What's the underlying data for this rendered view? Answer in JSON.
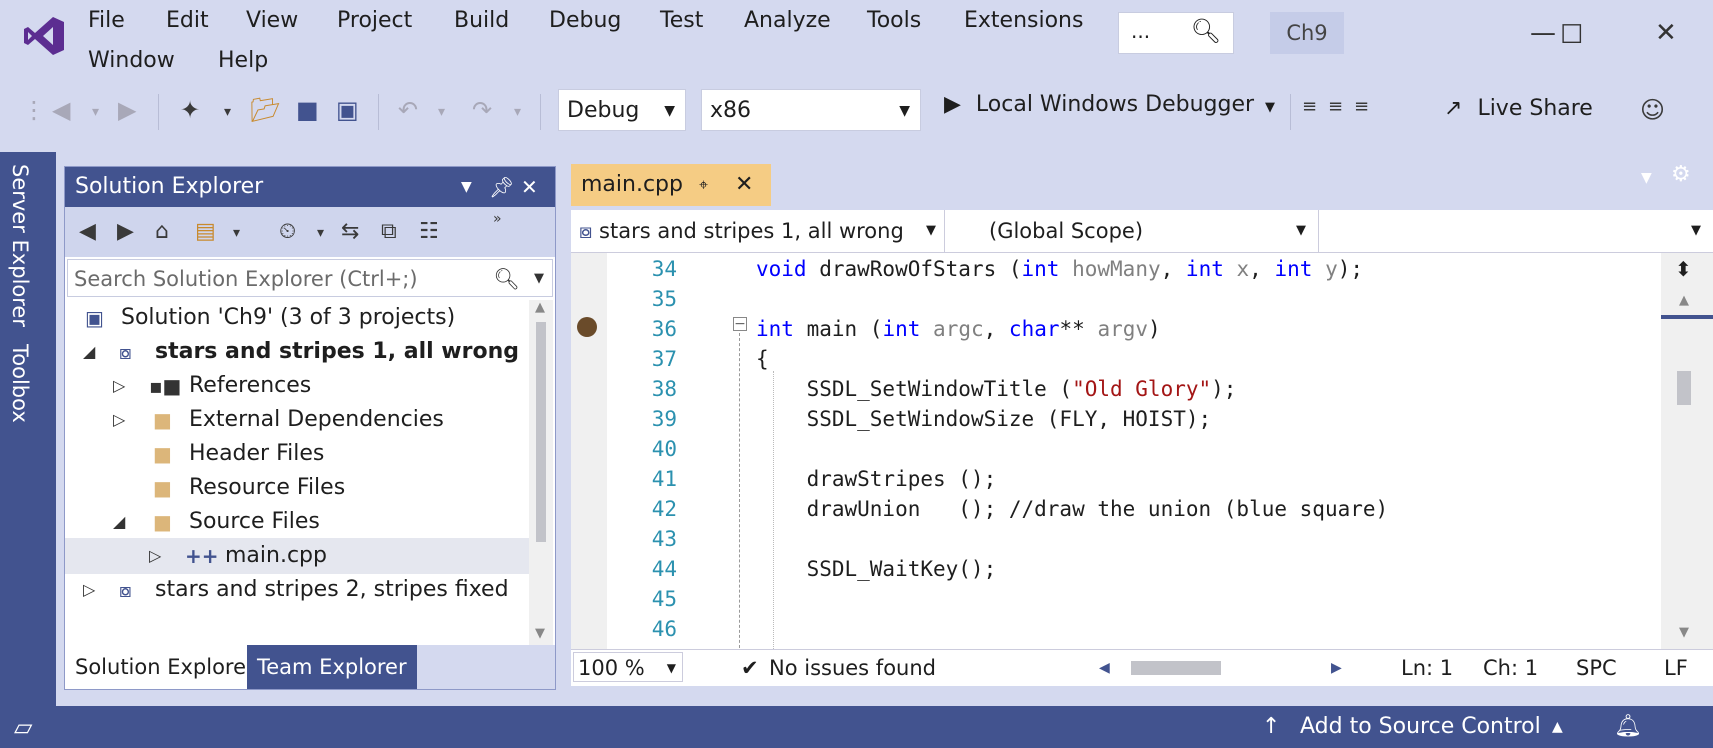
{
  "menu": {
    "items": [
      "File",
      "Edit",
      "View",
      "Project",
      "Build",
      "Debug",
      "Test",
      "Analyze",
      "Tools",
      "Extensions"
    ],
    "items_row2": [
      "Window",
      "Help"
    ],
    "search_placeholder": "...",
    "project_name": "Ch9"
  },
  "toolbar": {
    "configuration": "Debug",
    "platform": "x86",
    "run_label": "Local Windows Debugger",
    "live_share": "Live Share"
  },
  "side_tabs": [
    "Server Explorer",
    "Toolbox"
  ],
  "solution_explorer": {
    "title": "Solution Explorer",
    "search_placeholder": "Search Solution Explorer (Ctrl+;)",
    "tree": [
      {
        "label": "Solution 'Ch9' (3 of 3 projects)",
        "indent": 0,
        "icon": "solution-icon",
        "expander": ""
      },
      {
        "label": "stars and stripes 1, all wrong",
        "indent": 1,
        "icon": "cpp-project-icon",
        "expander": "expanded",
        "bold": true
      },
      {
        "label": "References",
        "indent": 2,
        "icon": "references-icon",
        "expander": "collapsed"
      },
      {
        "label": "External Dependencies",
        "indent": 2,
        "icon": "folder-icon",
        "expander": "collapsed"
      },
      {
        "label": "Header Files",
        "indent": 2,
        "icon": "filter-folder-icon",
        "expander": ""
      },
      {
        "label": "Resource Files",
        "indent": 2,
        "icon": "filter-folder-icon",
        "expander": ""
      },
      {
        "label": "Source Files",
        "indent": 2,
        "icon": "filter-folder-open-icon",
        "expander": "expanded"
      },
      {
        "label": "main.cpp",
        "indent": 3,
        "icon": "cpp-file-icon",
        "expander": "collapsed",
        "selected": true
      },
      {
        "label": "stars and stripes 2, stripes fixed",
        "indent": 1,
        "icon": "cpp-project-icon",
        "expander": "collapsed"
      }
    ],
    "bottom_tabs": [
      "Solution Explorer",
      "Team Explorer"
    ]
  },
  "editor": {
    "tab": "main.cpp",
    "nav_project": "stars and stripes 1, all wrong",
    "nav_scope": "(Global Scope)",
    "lines": [
      {
        "n": "34",
        "code": "void drawRowOfStars (int howMany, int x, int y);"
      },
      {
        "n": "35",
        "code": ""
      },
      {
        "n": "36",
        "code": "int main (int argc, char** argv)"
      },
      {
        "n": "37",
        "code": "{"
      },
      {
        "n": "38",
        "code": "    SSDL_SetWindowTitle (\"Old Glory\");"
      },
      {
        "n": "39",
        "code": "    SSDL_SetWindowSize (FLY, HOIST);"
      },
      {
        "n": "40",
        "code": ""
      },
      {
        "n": "41",
        "code": "    drawStripes ();"
      },
      {
        "n": "42",
        "code": "    drawUnion   (); //draw the union (blue square)"
      },
      {
        "n": "43",
        "code": ""
      },
      {
        "n": "44",
        "code": "    SSDL_WaitKey();"
      },
      {
        "n": "45",
        "code": ""
      },
      {
        "n": "46",
        "code": ""
      }
    ],
    "zoom": "100 %",
    "issues": "No issues found",
    "ln": "Ln: 1",
    "ch": "Ch: 1",
    "spc": "SPC",
    "lf": "LF"
  },
  "statusbar": {
    "source_control": "Add to Source Control"
  }
}
